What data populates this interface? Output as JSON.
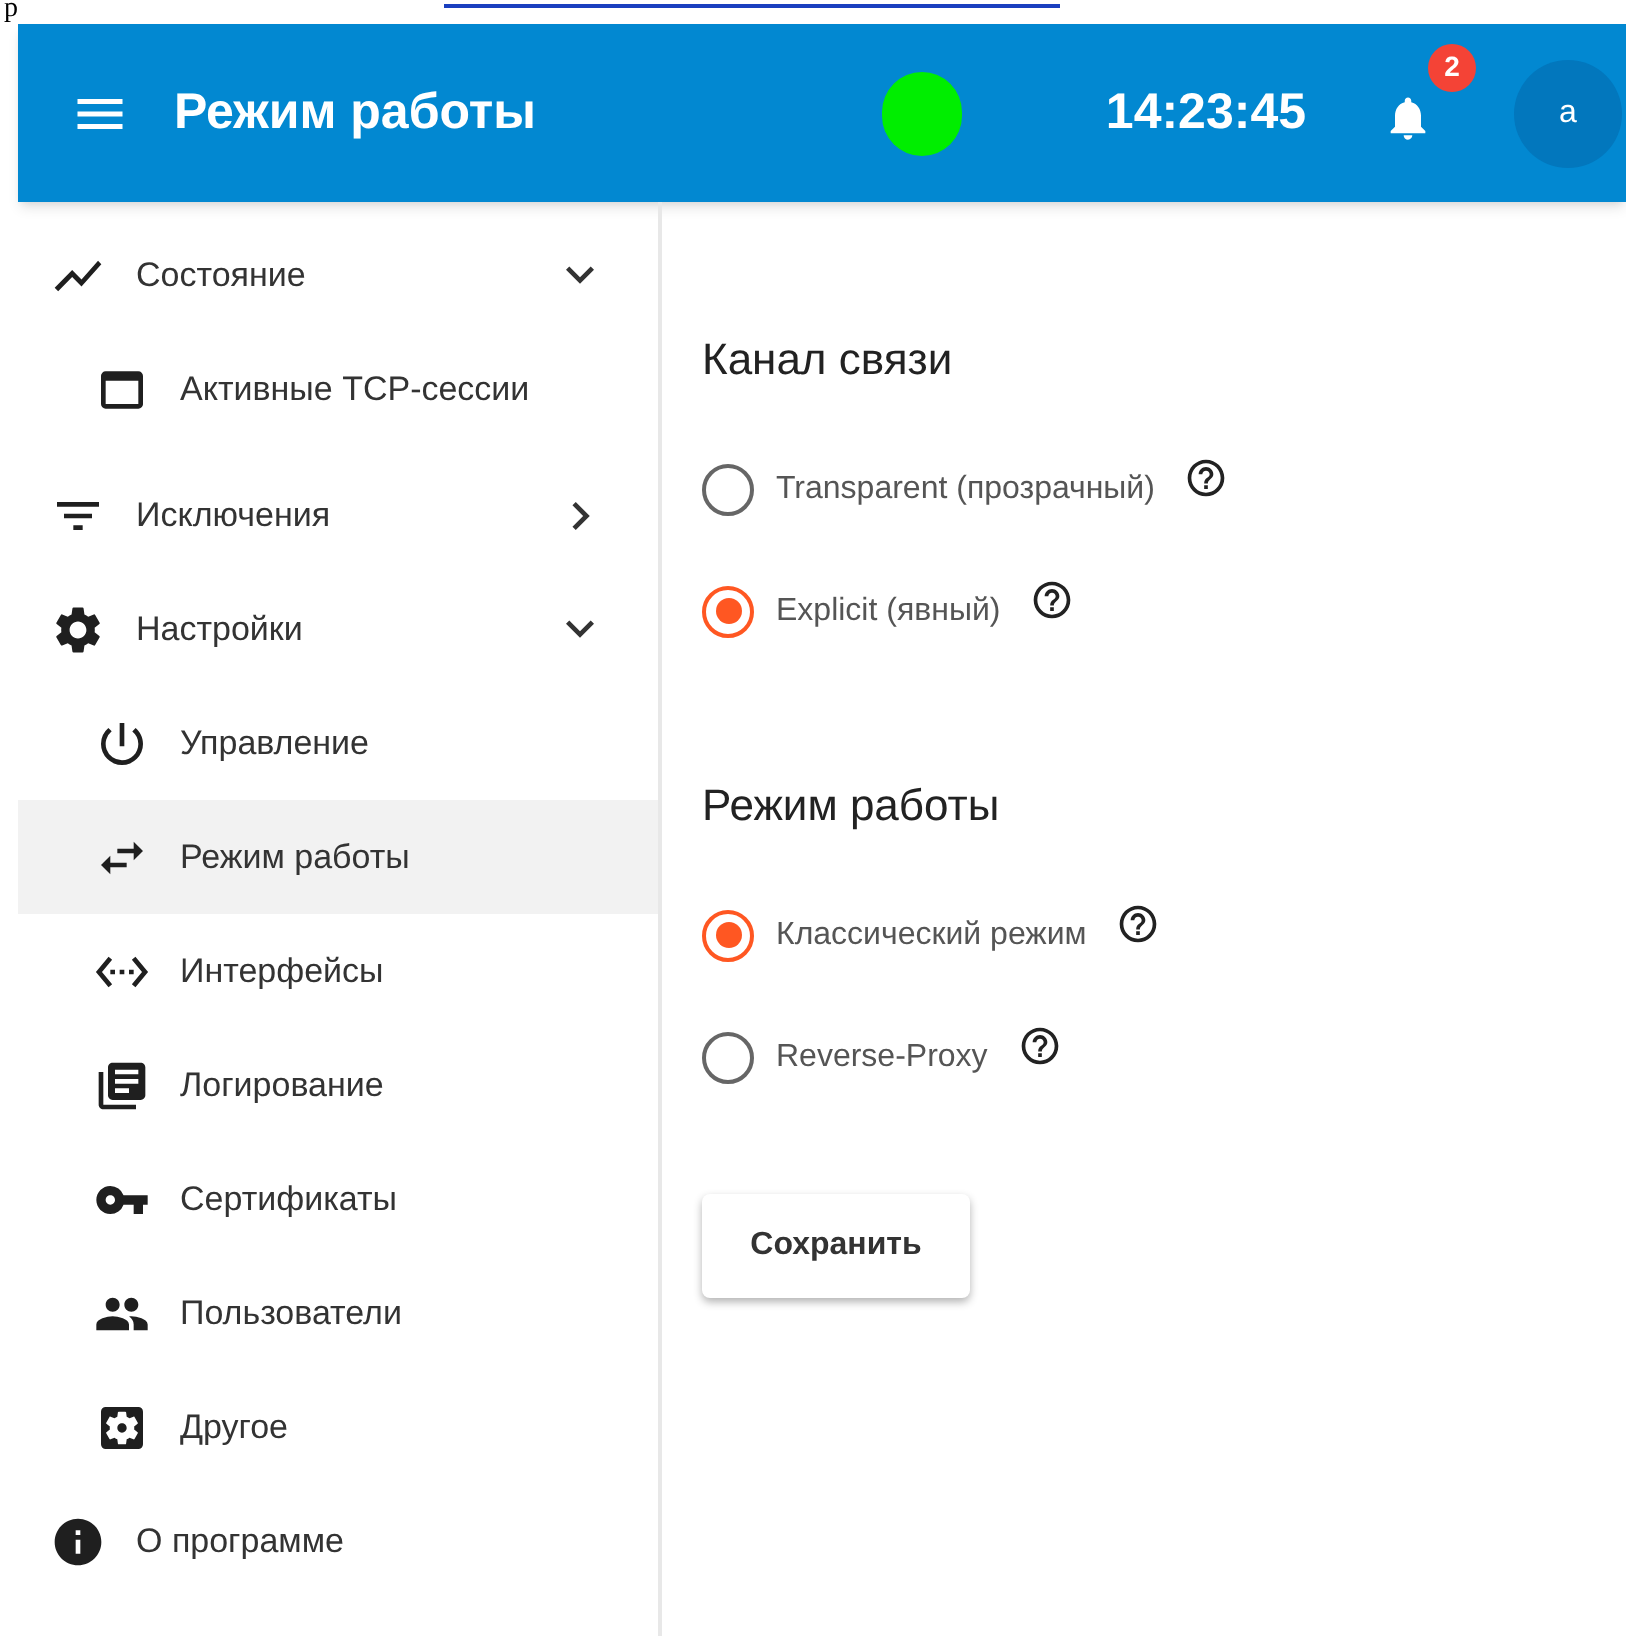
{
  "document_fragment": {
    "text": "р"
  },
  "header": {
    "title": "Режим работы",
    "connected": true,
    "time": "14:23:45",
    "notifications_count": "2",
    "avatar": "a"
  },
  "sidebar": {
    "items": [
      {
        "label": "Состояние",
        "expanded": true,
        "selected": false,
        "children": [
          {
            "label": "Активные TCP-сессии",
            "selected": false
          }
        ]
      },
      {
        "label": "Исключения",
        "expanded": false,
        "selected": false
      },
      {
        "label": "Настройки",
        "expanded": true,
        "selected": false,
        "children": [
          {
            "label": "Управление",
            "selected": false
          },
          {
            "label": "Режим работы",
            "selected": true
          },
          {
            "label": "Интерфейсы",
            "selected": false
          },
          {
            "label": "Логирование",
            "selected": false
          },
          {
            "label": "Сертификаты",
            "selected": false
          },
          {
            "label": "Пользователи",
            "selected": false
          },
          {
            "label": "Другое",
            "selected": false
          }
        ]
      },
      {
        "label": "О программе",
        "selected": false
      }
    ]
  },
  "sections": [
    {
      "title": "Канал связи",
      "options": [
        {
          "label": "Transparent (прозрачный)",
          "selected": false
        },
        {
          "label": "Explicit (явный)",
          "selected": true
        }
      ]
    },
    {
      "title": "Режим работы",
      "options": [
        {
          "label": "Классический режим",
          "selected": true
        },
        {
          "label": "Reverse-Proxy",
          "selected": false
        }
      ]
    }
  ],
  "save_button": "Сохранить"
}
